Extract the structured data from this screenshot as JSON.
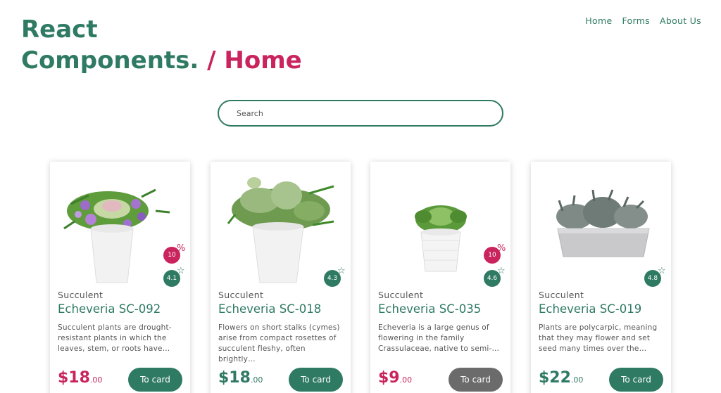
{
  "header": {
    "title_line1": "React",
    "title_line2": "Components.",
    "breadcrumb_sep": "/",
    "breadcrumb_current": "Home"
  },
  "nav": {
    "home": "Home",
    "forms": "Forms",
    "about": "About Us"
  },
  "search": {
    "placeholder": "Search",
    "value": ""
  },
  "colors": {
    "primary": "#2f7a63",
    "accent": "#c9245d",
    "disabled_button": "#6b6b6b"
  },
  "badge_marks": {
    "discount": "%",
    "rating": "☆"
  },
  "cards": [
    {
      "category": "Succulent",
      "name": "Echeveria SC-092",
      "description": "Succulent plants are drought-resistant plants in which the leaves, stem, or roots have…",
      "price_main": "$18",
      "price_cents": ".00",
      "discount": "10",
      "rating": "4.1",
      "button": "To card",
      "image": "succulent-in-white-pot-with-purple-flowers"
    },
    {
      "category": "Succulent",
      "name": "Echeveria SC-018",
      "description": "Flowers on short stalks (cymes) arise from compact rosettes of succulent fleshy, often brightly…",
      "price_main": "$18",
      "price_cents": ".00",
      "discount": "",
      "rating": "4.3",
      "button": "To card",
      "image": "large-succulent-in-white-pot"
    },
    {
      "category": "Succulent",
      "name": "Echeveria SC-035",
      "description": "Echeveria is a large genus of flowering in the family Crassulaceae, native to semi-…",
      "price_main": "$9",
      "price_cents": ".00",
      "discount": "10",
      "rating": "4.6",
      "button": "To card",
      "image": "small-succulent-in-white-pot"
    },
    {
      "category": "Succulent",
      "name": "Echeveria SC-019",
      "description": "Plants are polycarpic, meaning that they may flower and set seed many times over the…",
      "price_main": "$22",
      "price_cents": ".00",
      "discount": "",
      "rating": "4.8",
      "button": "To card",
      "image": "grey-succulents-in-rectangular-planter"
    }
  ]
}
